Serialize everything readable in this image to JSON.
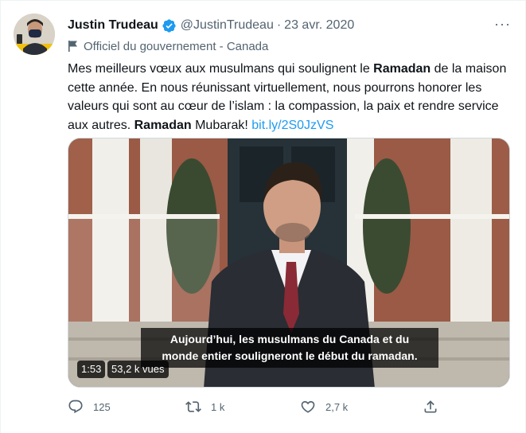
{
  "tweet": {
    "display_name": "Justin Trudeau",
    "handle": "@JustinTrudeau",
    "separator": "·",
    "date": "23 avr. 2020",
    "more": "···",
    "gov_label": "Officiel du gouvernement - Canada",
    "text": {
      "part1": "Mes meilleurs vœux aux musulmans qui soulignent le ",
      "bold1": "Ramadan",
      "part2": " de la maison cette année. En nous réunissant virtuellement, nous pourrons honorer les valeurs qui sont au cœur de l’islam : la compassion, la paix et rendre service aux autres. ",
      "bold2": "Ramadan",
      "part3": " Mubarak! ",
      "link": "bit.ly/2S0JzVS"
    },
    "video": {
      "caption_line1": "Aujourd’hui, les musulmans du Canada et du",
      "caption_line2": "monde entier souligneront le début du ramadan.",
      "duration": "1:53",
      "views": "53,2 k vues"
    },
    "actions": {
      "reply_count": "125",
      "retweet_count": "1 k",
      "like_count": "2,7 k"
    },
    "icons": [
      "verified-badge-icon",
      "flag-icon",
      "reply-icon",
      "retweet-icon",
      "like-icon",
      "share-icon"
    ],
    "colors": {
      "accent": "#1d9bf0",
      "secondary_text": "#536471",
      "primary_text": "#0f1419"
    }
  }
}
